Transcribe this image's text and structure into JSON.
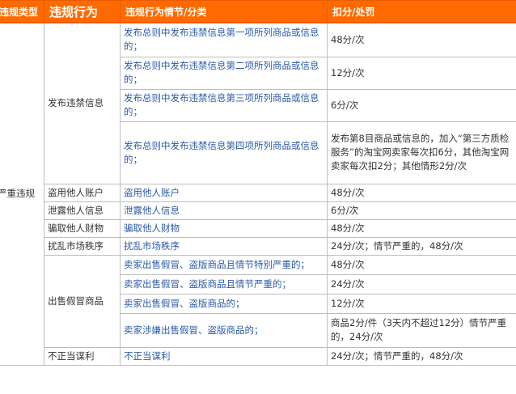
{
  "header": {
    "col1": "违规类型",
    "col2": "违规行为",
    "col3": "违规行为情节/分类",
    "col4": "扣分/处罚"
  },
  "category": "严重违规",
  "groups": [
    {
      "behavior": "发布违禁信息",
      "rows": [
        {
          "situation": "发布总则中发布违禁信息第一项所列商品或信息的；",
          "penalty": "48分/次"
        },
        {
          "situation": "发布总则中发布违禁信息第二项所列商品或信息的；",
          "penalty": "12分/次"
        },
        {
          "situation": "发布总则中发布违禁信息第三项所列商品或信息的；",
          "penalty": "6分/次"
        },
        {
          "situation": "发布总则中发布违禁信息第四项所列商品或信息的；",
          "penalty": "发布第8目商品或信息的，加入“第三方质检服务”的淘宝网卖家每次扣6分，其他淘宝网卖家每次扣2分；其他情形2分/次"
        }
      ]
    },
    {
      "behavior": "盗用他人账户",
      "rows": [
        {
          "situation": "盗用他人账户",
          "penalty": "48分/次"
        }
      ]
    },
    {
      "behavior": "泄露他人信息",
      "rows": [
        {
          "situation": "泄露他人信息",
          "penalty": "6分/次"
        }
      ]
    },
    {
      "behavior": "骗取他人财物",
      "rows": [
        {
          "situation": "骗取他人财物",
          "penalty": "48分/次"
        }
      ]
    },
    {
      "behavior": "扰乱市场秩序",
      "rows": [
        {
          "situation": "扰乱市场秩序",
          "penalty": "24分/次；情节严重的，48分/次"
        }
      ]
    },
    {
      "behavior": "出售假冒商品",
      "rows": [
        {
          "situation": "卖家出售假冒、盗版商品且情节特别严重的；",
          "penalty": "48分/次"
        },
        {
          "situation": "卖家出售假冒、盗版商品且情节严重的；",
          "penalty": "24分/次"
        },
        {
          "situation": "卖家出售假冒、盗版商品的；",
          "penalty": "12分/次"
        },
        {
          "situation": "卖家涉嫌出售假冒、盗版商品的；",
          "penalty": "商品2分/件（3天内不超过12分）情节严重的，24分/次"
        }
      ]
    },
    {
      "behavior": "不正当谋利",
      "rows": [
        {
          "situation": "不正当谋利",
          "penalty": "24分/次；情节严重的，48分/次"
        }
      ]
    }
  ]
}
